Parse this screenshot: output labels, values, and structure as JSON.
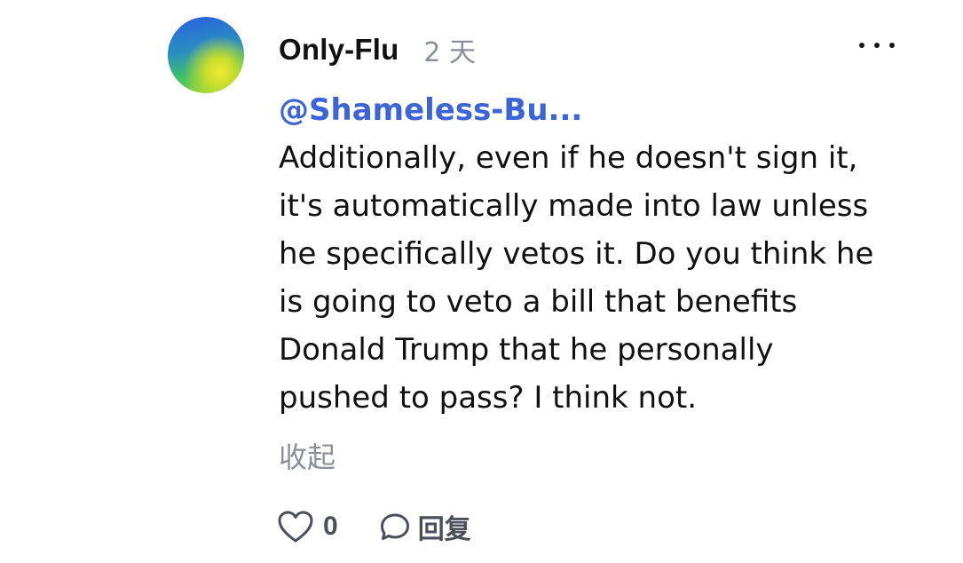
{
  "comment": {
    "author": "Only-Flu",
    "time": "2 天",
    "mention": "@Shameless-Bu...",
    "body": "Additionally, even if he doesn't sign it,\nit's automatically made into law unless\nhe specifically vetos it. Do you think he\nis going to veto a bill that benefits\nDonald Trump that he personally\npushed to pass? I think not.",
    "collapse_label": "收起",
    "like_count": "0",
    "reply_label": "回复"
  },
  "icons": {
    "avatar": "avatar-image",
    "more": "more-horizontal-icon",
    "like": "heart-outline-icon",
    "reply": "speech-bubble-icon"
  },
  "colors": {
    "mention": "#3d63d8",
    "muted": "#8a8f99",
    "text": "#111111"
  }
}
